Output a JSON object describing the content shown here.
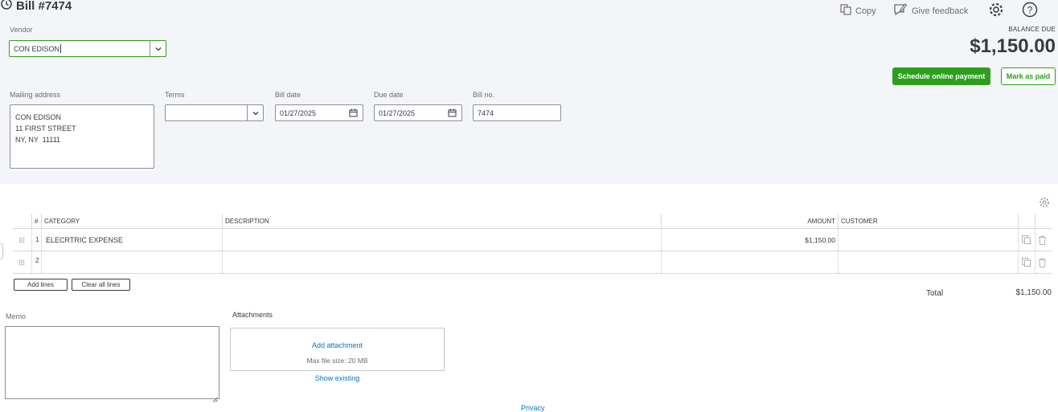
{
  "header": {
    "title": "Bill #7474",
    "copy_label": "Copy",
    "feedback_label": "Give feedback"
  },
  "vendor": {
    "label": "Vendor",
    "value": "CON EDISON"
  },
  "balance": {
    "label": "BALANCE DUE",
    "amount": "$1,150.00"
  },
  "actions": {
    "schedule_label": "Schedule online payment",
    "mark_paid_label": "Mark as paid"
  },
  "mailing": {
    "label": "Mailing address",
    "value": "CON EDISON\n11 FIRST STREET\nNY, NY  11111"
  },
  "terms": {
    "label": "Terms",
    "value": ""
  },
  "bill_date": {
    "label": "Bill date",
    "value": "01/27/2025"
  },
  "due_date": {
    "label": "Due date",
    "value": "01/27/2025"
  },
  "bill_no": {
    "label": "Bill no.",
    "value": "7474"
  },
  "table": {
    "headers": {
      "num": "#",
      "category": "CATEGORY",
      "description": "DESCRIPTION",
      "amount": "AMOUNT",
      "customer": "CUSTOMER"
    },
    "rows": [
      {
        "num": "1",
        "category": "ELECRTRIC EXPENSE",
        "description": "",
        "amount": "$1,150.00",
        "customer": ""
      },
      {
        "num": "2",
        "category": "",
        "description": "",
        "amount": "",
        "customer": ""
      }
    ]
  },
  "buttons": {
    "add_lines": "Add lines",
    "clear_lines": "Clear all lines"
  },
  "total": {
    "label": "Total",
    "amount": "$1,150.00"
  },
  "memo": {
    "label": "Memo",
    "value": ""
  },
  "attachments": {
    "label": "Attachments",
    "add_label": "Add attachment",
    "max_size": "Max file size: 20 MB",
    "show_existing": "Show existing"
  },
  "footer": {
    "privacy": "Privacy"
  },
  "colors": {
    "accent": "#2ca01c",
    "link": "#0077c5"
  }
}
